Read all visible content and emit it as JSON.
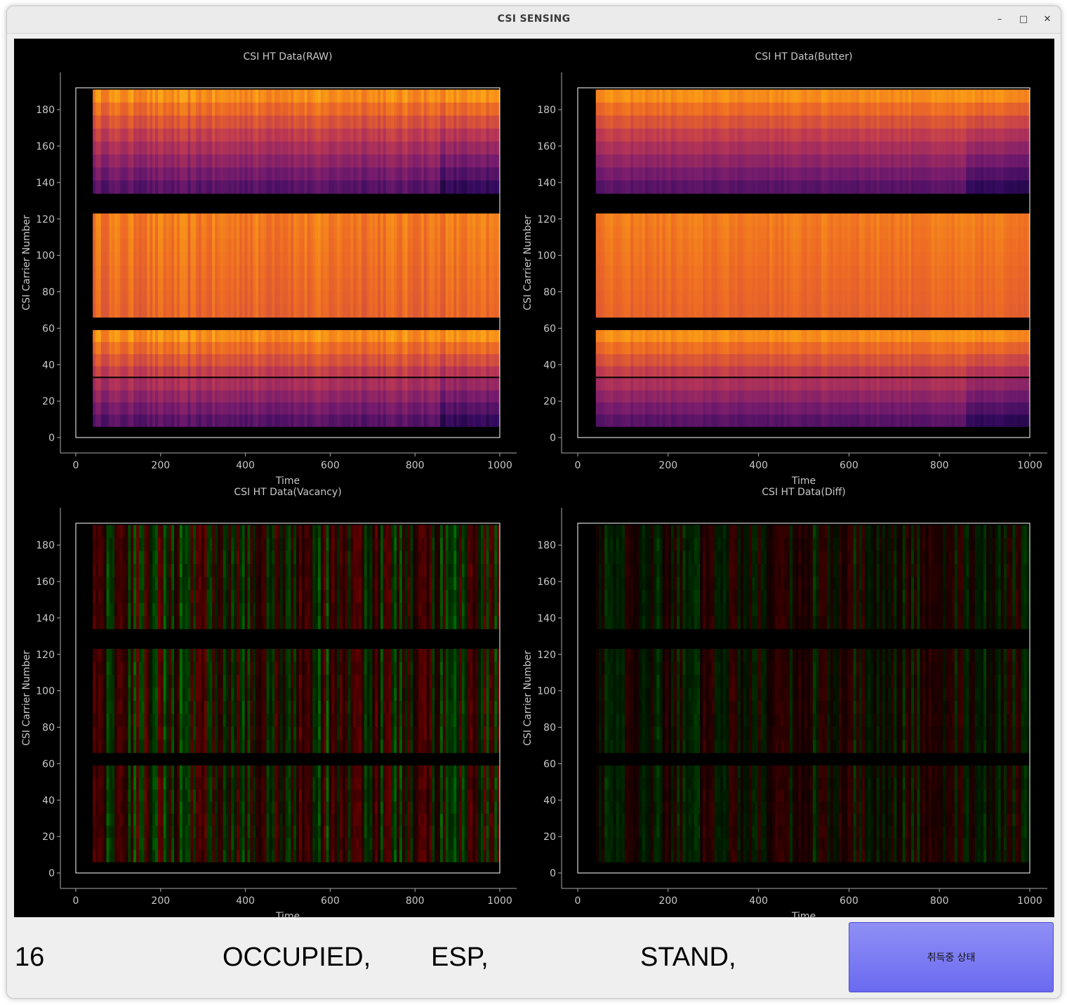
{
  "window": {
    "title": "CSI SENSING",
    "minimize_glyph": "–",
    "maximize_glyph": "□",
    "close_glyph": "✕"
  },
  "status": {
    "count": "16",
    "occupancy": "OCCUPIED,",
    "device": "ESP,",
    "posture": "STAND,"
  },
  "action_button": {
    "label": "취득중 상태",
    "color": "#7b7bf4"
  },
  "chart_data": [
    {
      "type": "heatmap",
      "title": "CSI HT Data(RAW)",
      "xlabel": "Time",
      "ylabel": "CSI Carrier Number",
      "xlim": [
        0,
        1000
      ],
      "ylim": [
        0,
        192
      ],
      "xticks": [
        0,
        200,
        400,
        600,
        800,
        1000
      ],
      "yticks": [
        0,
        20,
        40,
        60,
        80,
        100,
        120,
        140,
        160,
        180
      ],
      "data_x_range": [
        40,
        1000
      ],
      "carrier_bands": [
        [
          6,
          59
        ],
        [
          66,
          123
        ],
        [
          134,
          191
        ]
      ],
      "colormap": "inferno"
    },
    {
      "type": "heatmap",
      "title": "CSI HT Data(Butter)",
      "xlabel": "Time",
      "ylabel": "CSI Carrier Number",
      "xlim": [
        0,
        1000
      ],
      "ylim": [
        0,
        192
      ],
      "xticks": [
        0,
        200,
        400,
        600,
        800,
        1000
      ],
      "yticks": [
        0,
        20,
        40,
        60,
        80,
        100,
        120,
        140,
        160,
        180
      ],
      "data_x_range": [
        40,
        1000
      ],
      "carrier_bands": [
        [
          6,
          59
        ],
        [
          66,
          123
        ],
        [
          134,
          191
        ]
      ],
      "colormap": "inferno"
    },
    {
      "type": "heatmap",
      "title": "CSI HT Data(Vacancy)",
      "xlabel": "",
      "ylabel": "CSI Carrier Number",
      "xlim": [
        0,
        1000
      ],
      "ylim": [
        0,
        192
      ],
      "xticks": [
        0,
        200,
        400,
        600,
        800,
        1000
      ],
      "yticks": [
        0,
        20,
        40,
        60,
        80,
        100,
        120,
        140,
        160,
        180
      ],
      "data_x_range": [
        40,
        1000
      ],
      "carrier_bands": [
        [
          6,
          59
        ],
        [
          66,
          123
        ],
        [
          134,
          191
        ]
      ],
      "colormap": "red-green diverging"
    },
    {
      "type": "heatmap",
      "title": "CSI HT Data(Diff)",
      "xlabel": "",
      "ylabel": "CSI Carrier Number",
      "xlim": [
        0,
        1000
      ],
      "ylim": [
        0,
        192
      ],
      "xticks": [
        0,
        200,
        400,
        600,
        800,
        1000
      ],
      "yticks": [
        0,
        20,
        40,
        60,
        80,
        100,
        120,
        140,
        160,
        180
      ],
      "data_x_range": [
        40,
        1000
      ],
      "carrier_bands": [
        [
          6,
          59
        ],
        [
          66,
          123
        ],
        [
          134,
          191
        ]
      ],
      "colormap": "red-green diverging (dim)"
    }
  ],
  "bottom_x_label": "Time"
}
